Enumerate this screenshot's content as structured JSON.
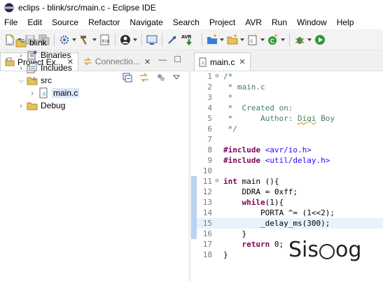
{
  "window": {
    "title": "eclips - blink/src/main.c - Eclipse IDE"
  },
  "menu": [
    "File",
    "Edit",
    "Source",
    "Refactor",
    "Navigate",
    "Search",
    "Project",
    "AVR",
    "Run",
    "Window",
    "Help"
  ],
  "toolbar": {
    "avr_label": "AVR"
  },
  "left_tabs": [
    {
      "label": "Project Ex...",
      "close": "✕"
    },
    {
      "label": "Connectio...",
      "close": "✕"
    }
  ],
  "view_controls": {
    "minimize": "—",
    "maximize": "☐"
  },
  "tree": [
    {
      "label": "blink"
    },
    {
      "label": "Binaries"
    },
    {
      "label": "Includes"
    },
    {
      "label": "src"
    },
    {
      "label": "main.c"
    },
    {
      "label": "Debug"
    }
  ],
  "editor": {
    "tab_label": "main.c",
    "tab_close": "✕",
    "line_numbers": [
      "1",
      "2",
      "3",
      "4",
      "5",
      "6",
      "7",
      "8",
      "9",
      "10",
      "11",
      "12",
      "13",
      "14",
      "15",
      "16",
      "17",
      "18"
    ]
  },
  "code": {
    "l1": "/*",
    "l2": " * main.c",
    "l3": " *",
    "l4a": " *  Created on:",
    "l5a": " *      Author: ",
    "l5b": "Digi",
    "l5c": " Boy",
    "l6": " */",
    "l8kw": "#include",
    "l8str": "<avr/io.h>",
    "l9kw": "#include",
    "l9str": "<util/delay.h>",
    "l11kw": "int",
    "l11rest": " main (){",
    "l12": "    DDRA = 0xff;",
    "l13kw": "while",
    "l13rest": "(1){",
    "l14": "        PORTA ^= (1<<2);",
    "l15": "        _delay_ms(300);",
    "l16": "    }",
    "l17kw": "return",
    "l17rest": " 0;",
    "l18": "}"
  },
  "watermark": {
    "left": "Sis",
    "right": "og"
  }
}
